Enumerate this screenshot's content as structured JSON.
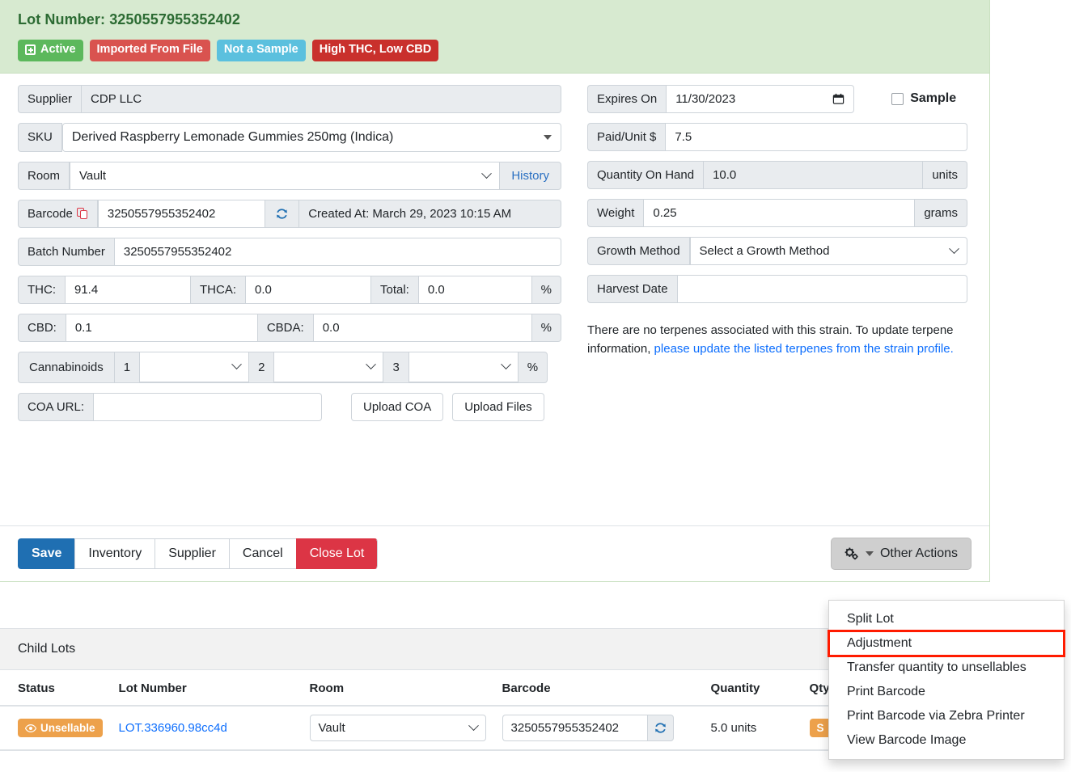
{
  "lot": {
    "title": "Lot Number: 3250557955352402",
    "badges": [
      {
        "label": "Active",
        "color": "#5cb85c",
        "icon": "plus-square-icon"
      },
      {
        "label": "Imported From File",
        "color": "#d9534f",
        "icon": ""
      },
      {
        "label": "Not a Sample",
        "color": "#5bc0de",
        "icon": ""
      },
      {
        "label": "High THC, Low CBD",
        "color": "#c9302c",
        "icon": ""
      }
    ]
  },
  "form": {
    "supplier_label": "Supplier",
    "supplier_value": "CDP LLC",
    "sku_label": "SKU",
    "sku_value": "Derived Raspberry Lemonade Gummies 250mg (Indica)",
    "room_label": "Room",
    "room_value": "Vault",
    "history_label": "History",
    "barcode_label": "Barcode",
    "barcode_value": "3250557955352402",
    "created_at": "Created At: March 29, 2023 10:15 AM",
    "batch_label": "Batch Number",
    "batch_value": "3250557955352402",
    "thc_label": "THC:",
    "thc_value": "91.4",
    "thca_label": "THCA:",
    "thca_value": "0.0",
    "total_label": "Total:",
    "total_value": "0.0",
    "pct": "%",
    "cbd_label": "CBD:",
    "cbd_value": "0.1",
    "cbda_label": "CBDA:",
    "cbda_value": "0.0",
    "cannabinoids_label": "Cannabinoids",
    "cannabinoid_rows": [
      {
        "index": "1",
        "select_value": "",
        "amount_value": ""
      },
      {
        "index": "2",
        "select_value": "",
        "amount_value": ""
      },
      {
        "index": "3",
        "select_value": "",
        "amount_value": ""
      }
    ],
    "coa_label": "COA URL:",
    "coa_value": "",
    "upload_coa_label": "Upload COA",
    "upload_files_label": "Upload Files",
    "expires_label": "Expires On",
    "expires_value": "11/30/2023",
    "sample_label": "Sample",
    "sample_checked": false,
    "paid_unit_label": "Paid/Unit $",
    "paid_unit_value": "7.5",
    "qoh_label": "Quantity On Hand",
    "qoh_value": "10.0",
    "qoh_unit": "units",
    "weight_label": "Weight",
    "weight_value": "0.25",
    "weight_unit": "grams",
    "growth_label": "Growth Method",
    "growth_value": "Select a Growth Method",
    "harvest_label": "Harvest Date",
    "harvest_value": "",
    "terpene_text": "There are no terpenes associated with this strain. To update terpene information, ",
    "terpene_link": "please update the listed terpenes from the strain profile."
  },
  "footer": {
    "save_label": "Save",
    "inventory_label": "Inventory",
    "supplier_label": "Supplier",
    "cancel_label": "Cancel",
    "close_lot_label": "Close Lot",
    "other_actions_label": "Other Actions"
  },
  "dropdown": {
    "items": [
      {
        "label": "Split Lot",
        "highlighted": false
      },
      {
        "label": "Adjustment",
        "highlighted": true
      },
      {
        "label": "Transfer quantity to unsellables",
        "highlighted": false
      },
      {
        "label": "Print Barcode",
        "highlighted": false
      },
      {
        "label": "Print Barcode via Zebra Printer",
        "highlighted": false
      },
      {
        "label": "View Barcode Image",
        "highlighted": false
      }
    ],
    "highlight_color": "#ff1b00"
  },
  "child_lots": {
    "panel_title": "Child Lots",
    "columns": [
      "Status",
      "Lot Number",
      "Room",
      "Barcode",
      "Quantity",
      "Qty"
    ],
    "rows": [
      {
        "status": "Unsellable",
        "status_color": "#eda14b",
        "lot_number": "LOT.336960.98cc4d",
        "room": "Vault",
        "barcode": "3250557955352402",
        "quantity": "5.0 units",
        "qty_badge": "S"
      }
    ]
  }
}
